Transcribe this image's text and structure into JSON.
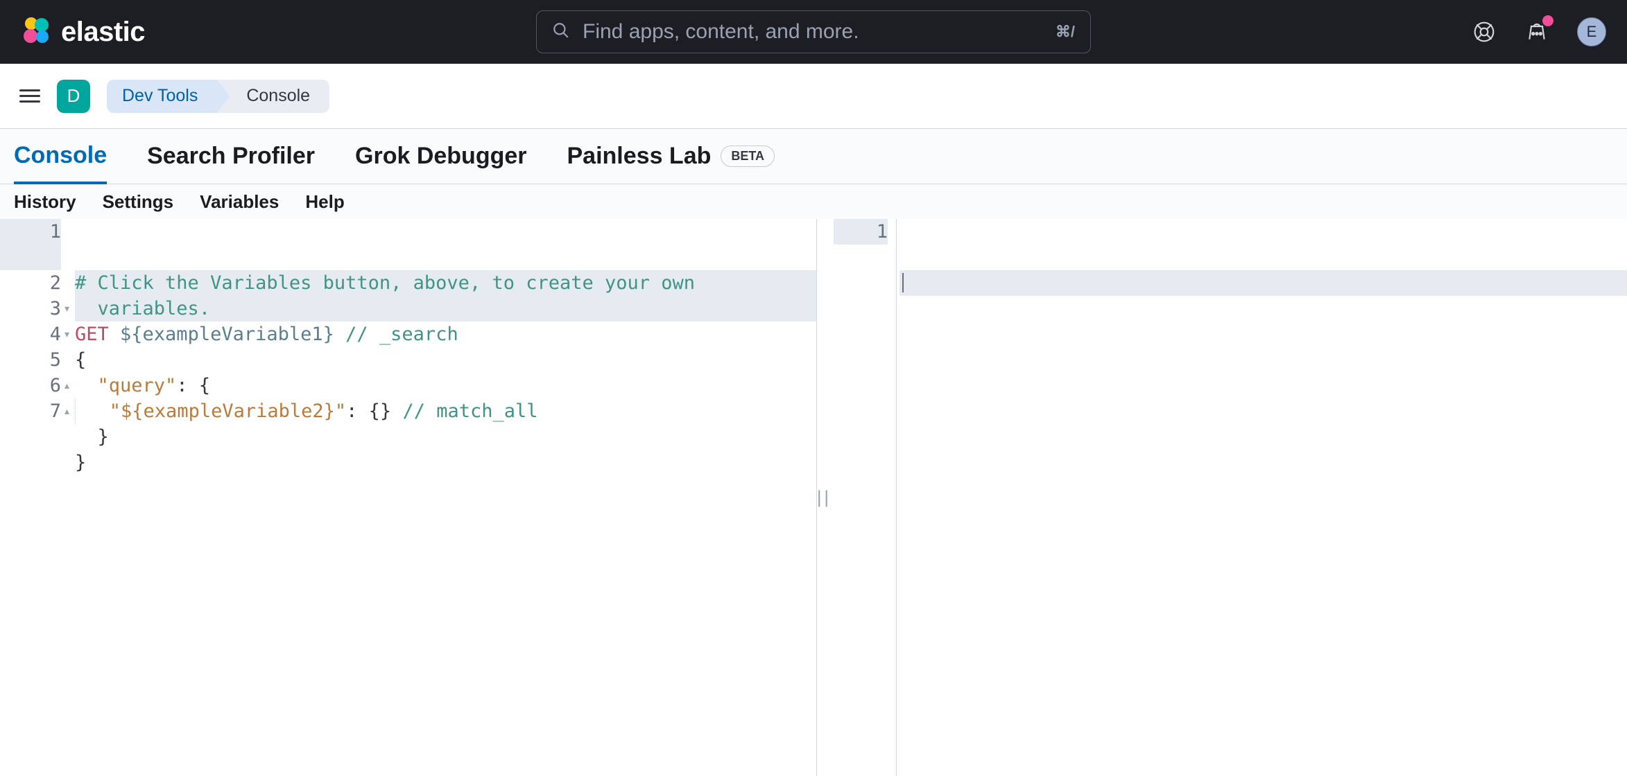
{
  "header": {
    "product": "elastic",
    "search_placeholder": "Find apps, content, and more.",
    "shortcut": "⌘/",
    "avatar_initial": "E"
  },
  "breadcrumb": {
    "space_initial": "D",
    "items": [
      "Dev Tools",
      "Console"
    ]
  },
  "tabs": {
    "items": [
      "Console",
      "Search Profiler",
      "Grok Debugger",
      "Painless Lab"
    ],
    "beta_label": "BETA",
    "active_index": 0
  },
  "toolbar": {
    "links": [
      "History",
      "Settings",
      "Variables",
      "Help"
    ]
  },
  "editor": {
    "left_gutter": [
      "1",
      "2",
      "3",
      "4",
      "5",
      "6",
      "7"
    ],
    "right_gutter": [
      "1"
    ],
    "line1a": "# Click the Variables button, above, to create your own",
    "line1b": "  variables.",
    "l2_method": "GET ",
    "l2_var": "${exampleVariable1}",
    "l2_comment": " // _search",
    "l3": "{",
    "l4_key": "\"query\"",
    "l4_rest": ": {",
    "l5_pre": "    ",
    "l5_key": "\"${exampleVariable2}\"",
    "l5_mid": ": {} ",
    "l5_comment": "// match_all",
    "l6": "  }",
    "l7": "}"
  }
}
